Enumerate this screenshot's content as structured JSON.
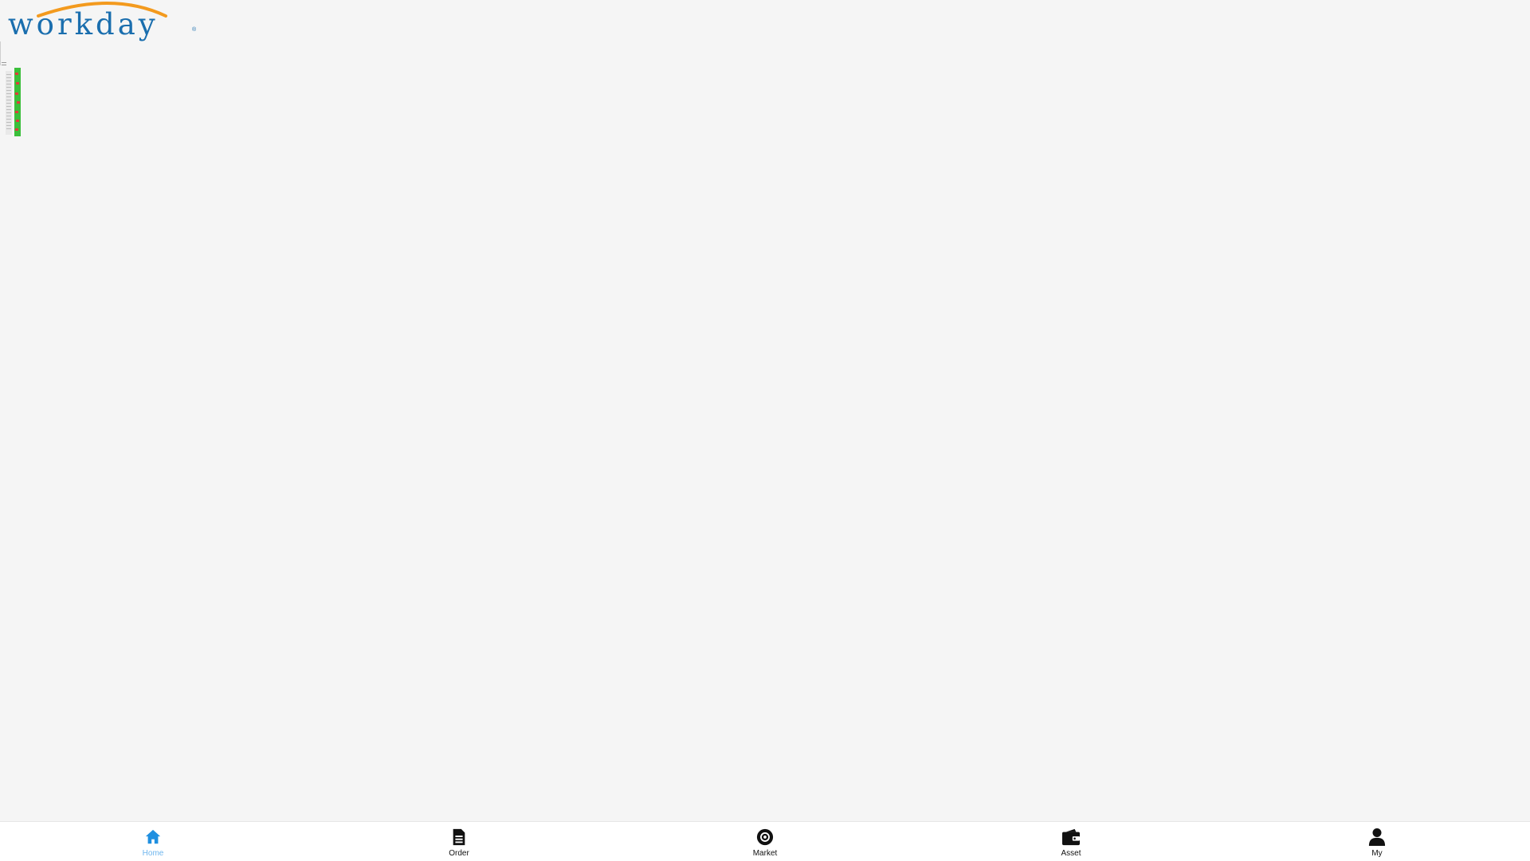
{
  "brand": {
    "logo_text": "workday",
    "logo_mark": "®",
    "arc_color": "#f39a1e",
    "text_color": "#1a6eae"
  },
  "colors": {
    "active": "#1f8fe0",
    "active_label": "#6fb6ee",
    "inactive": "#111111",
    "background": "#f5f5f5"
  },
  "tabbar": {
    "tabs": [
      {
        "label": "Home",
        "icon": "home-icon",
        "active": true
      },
      {
        "label": "Order",
        "icon": "document-icon",
        "active": false
      },
      {
        "label": "Market",
        "icon": "market-icon",
        "active": false
      },
      {
        "label": "Asset",
        "icon": "wallet-icon",
        "active": false
      },
      {
        "label": "My",
        "icon": "user-icon",
        "active": false
      }
    ]
  }
}
